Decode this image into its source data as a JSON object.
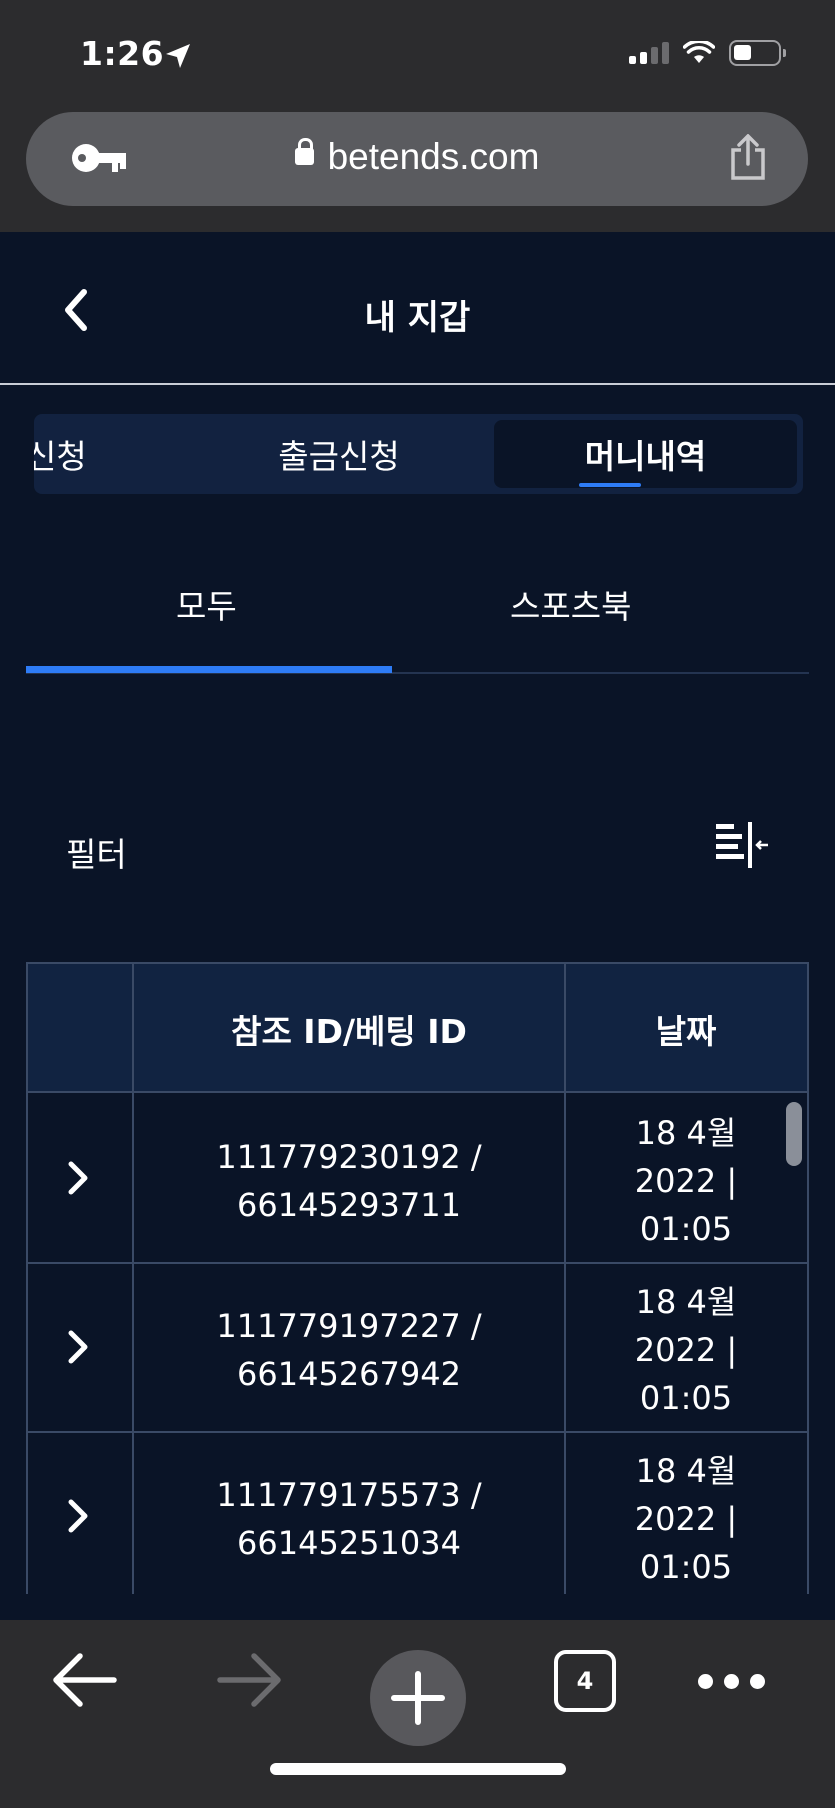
{
  "status_bar": {
    "time": "1:26",
    "location_icon": "location-arrow-icon",
    "signal_icon": "cellular-signal-icon",
    "wifi_icon": "wifi-icon",
    "battery_icon": "battery-icon"
  },
  "browser": {
    "url": "betends.com",
    "key_icon": "key-icon",
    "lock_icon": "lock-icon",
    "share_icon": "share-icon"
  },
  "header": {
    "title": "내 지갑",
    "back_icon": "chevron-left-icon"
  },
  "segment_tabs": [
    {
      "label": "신청",
      "active": false
    },
    {
      "label": "출금신청",
      "active": false
    },
    {
      "label": "머니내역",
      "active": true
    }
  ],
  "sub_tabs": [
    {
      "label": "모두",
      "active": true
    },
    {
      "label": "스포츠북",
      "active": false
    }
  ],
  "filter": {
    "label": "필터",
    "icon": "filter-collapse-icon"
  },
  "table": {
    "columns": [
      "",
      "참조 ID/베팅 ID",
      "날짜"
    ],
    "rows": [
      {
        "ref_line1": "111779230192 /",
        "ref_line2": "66145293711",
        "date_line1": "18 4월",
        "date_line2": "2022 |",
        "date_line3": "01:05"
      },
      {
        "ref_line1": "111779197227 /",
        "ref_line2": "66145267942",
        "date_line1": "18 4월",
        "date_line2": "2022 |",
        "date_line3": "01:05"
      },
      {
        "ref_line1": "111779175573 /",
        "ref_line2": "66145251034",
        "date_line1": "18 4월",
        "date_line2": "2022 |",
        "date_line3": "01:05"
      }
    ]
  },
  "toolbar": {
    "back_icon": "arrow-left-icon",
    "forward_icon": "arrow-right-icon",
    "new_tab_icon": "plus-icon",
    "tab_count": "4",
    "more_icon": "more-dots-icon"
  },
  "colors": {
    "background": "#0a1427",
    "accent": "#2e7cf6",
    "header_cell": "#112341"
  }
}
